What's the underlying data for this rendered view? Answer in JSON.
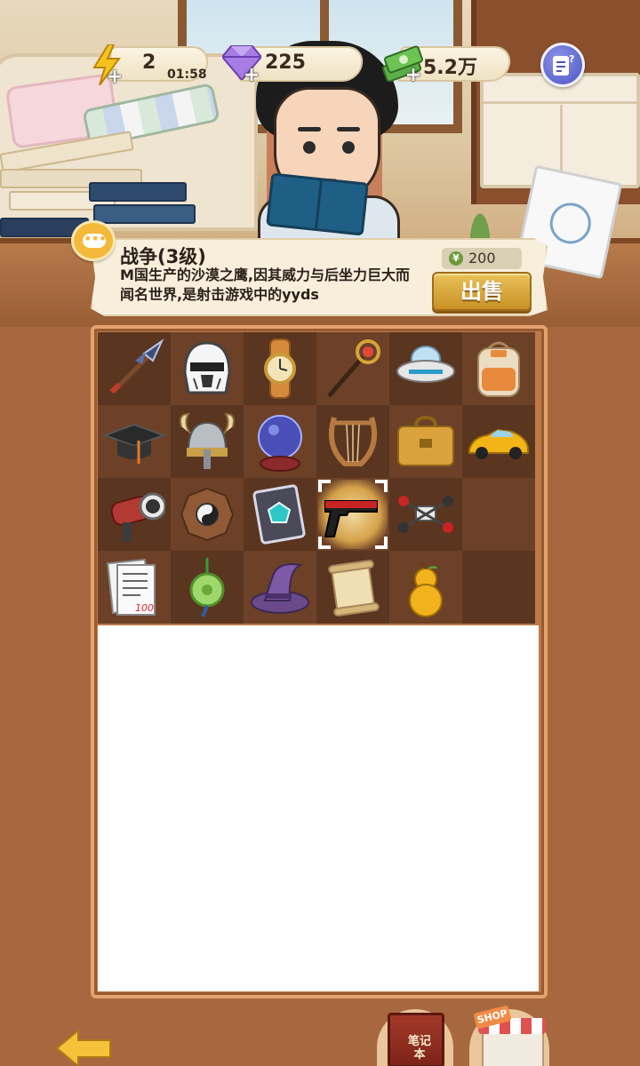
{
  "status_bar": {
    "energy": {
      "icon": "lightning-icon",
      "value": "2",
      "timer": "01:58"
    },
    "gems": {
      "icon": "gem-icon",
      "value": "225"
    },
    "cash": {
      "icon": "money-stack-icon",
      "value": "5.2万"
    },
    "help_icon": "help-document-icon"
  },
  "info_panel": {
    "title": "战争(3级)",
    "description": "M国生产的沙漠之鹰,因其威力与后坐力巨大而闻名世界,是射击游戏中的yyds",
    "price_currency_symbol": "¥",
    "price": "200",
    "sell_label": "出售"
  },
  "inventory": {
    "selected_index": 15,
    "items": [
      {
        "name": "spear-icon"
      },
      {
        "name": "stormtrooper-helmet-icon"
      },
      {
        "name": "wristwatch-icon"
      },
      {
        "name": "magic-staff-icon"
      },
      {
        "name": "ufo-icon"
      },
      {
        "name": "backpack-icon"
      },
      {
        "name": "graduation-cap-icon"
      },
      {
        "name": "viking-helmet-icon"
      },
      {
        "name": "crystal-ball-icon"
      },
      {
        "name": "lyre-icon"
      },
      {
        "name": "briefcase-icon"
      },
      {
        "name": "sports-car-icon"
      },
      {
        "name": "telescope-icon"
      },
      {
        "name": "bagua-compass-icon"
      },
      {
        "name": "spellbook-icon"
      },
      {
        "name": "desert-eagle-pistol-icon"
      },
      {
        "name": "drone-icon"
      },
      {
        "name": "empty-slot"
      },
      {
        "name": "test-paper-icon"
      },
      {
        "name": "jade-pendant-icon"
      },
      {
        "name": "witch-hat-icon"
      },
      {
        "name": "scroll-icon"
      },
      {
        "name": "gourd-icon"
      },
      {
        "name": "empty-slot"
      }
    ],
    "score_on_paper": "100"
  },
  "bottom_bar": {
    "back_icon": "back-arrow-icon",
    "notebook_label": "笔记本",
    "shop_label": "SHOP"
  }
}
